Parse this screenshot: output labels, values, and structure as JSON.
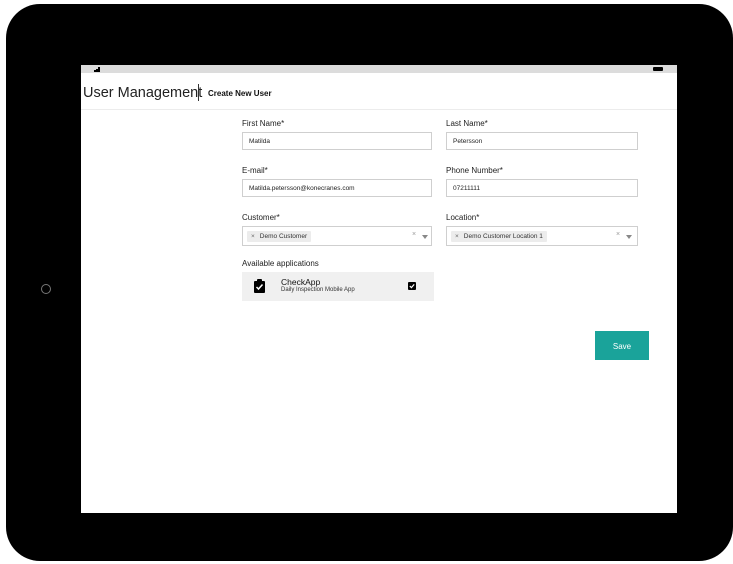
{
  "header": {
    "title": "User Management",
    "subtitle": "Create New User"
  },
  "form": {
    "first_name": {
      "label": "First Name*",
      "value": "Matilda"
    },
    "last_name": {
      "label": "Last Name*",
      "value": "Petersson"
    },
    "email": {
      "label": "E-mail*",
      "value": "Matilda.petersson@konecranes.com"
    },
    "phone": {
      "label": "Phone Number*",
      "value": "07211111"
    },
    "customer": {
      "label": "Customer*",
      "selected": "Demo Customer",
      "chip_remove": "×",
      "clear": "×"
    },
    "location": {
      "label": "Location*",
      "selected": "Demo Customer Location 1",
      "chip_remove": "×",
      "clear": "×"
    }
  },
  "applications": {
    "heading": "Available applications",
    "items": [
      {
        "name": "CheckApp",
        "description": "Daily Inspection Mobile App",
        "checked": true,
        "icon": "clipboard-check-icon"
      }
    ]
  },
  "actions": {
    "save_label": "Save"
  },
  "colors": {
    "accent": "#1aa39a",
    "device_frame": "#000000"
  }
}
